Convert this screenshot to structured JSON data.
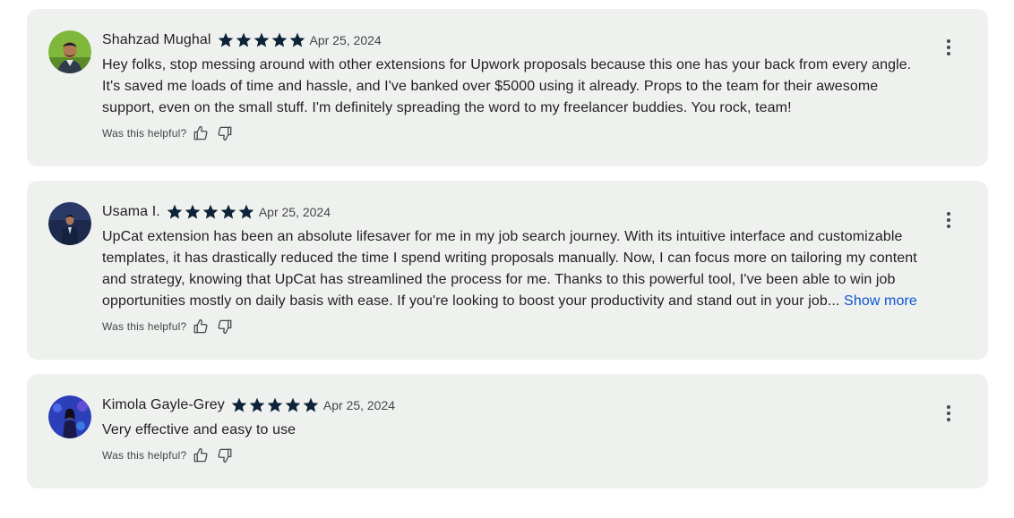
{
  "reviews": [
    {
      "name": "Shahzad Mughal",
      "rating": 5,
      "date": "Apr 25, 2024",
      "text": "Hey folks, stop messing around with other extensions for Upwork proposals because this one has your back from every angle. It's saved me loads of time and hassle, and I've banked over $5000 using it already. Props to the team for their awesome support, even on the small stuff. I'm definitely spreading the word to my freelancer buddies. You rock, team!",
      "helpful_label": "Was this helpful?",
      "avatar_icon": "person-photo-avatar"
    },
    {
      "name": "Usama I.",
      "rating": 5,
      "date": "Apr 25, 2024",
      "text": "UpCat extension has been an absolute lifesaver for me in my job search journey. With its intuitive interface and customizable templates, it has drastically reduced the time I spend writing proposals manually. Now, I can focus more on tailoring my content and strategy, knowing that UpCat has streamlined the process for me. Thanks to this powerful tool, I've been able to win job opportunities mostly on daily basis with ease. If you're looking to boost your productivity and stand out in your job...",
      "show_more": "Show more",
      "helpful_label": "Was this helpful?",
      "avatar_icon": "person-photo-avatar"
    },
    {
      "name": "Kimola Gayle-Grey",
      "rating": 5,
      "date": "Apr 25, 2024",
      "text": "Very effective and easy to use",
      "helpful_label": "Was this helpful?",
      "avatar_icon": "person-photo-avatar"
    }
  ],
  "colors": {
    "card_bg": "#eff1ef",
    "star": "#0c2338",
    "link": "#0b57d0",
    "muted_text": "#444746"
  }
}
